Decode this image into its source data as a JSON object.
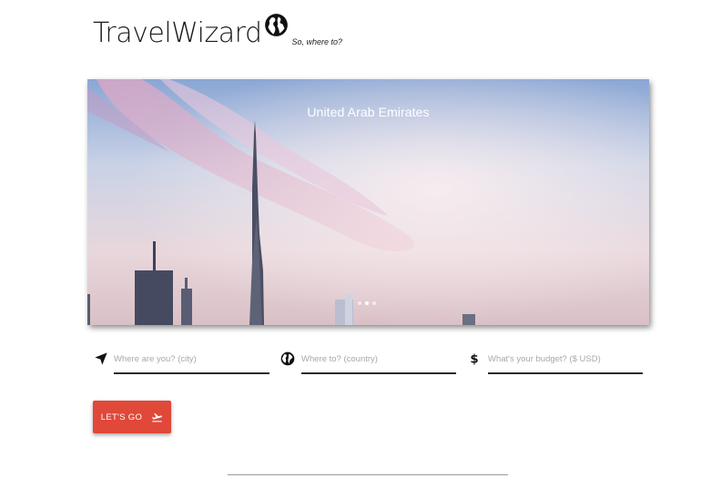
{
  "brand": {
    "title": "TravelWizard",
    "tagline": "So, where to?",
    "logo_icon": "globe-icon"
  },
  "carousel": {
    "caption": "United Arab Emirates",
    "slide_count": 3,
    "active_slide": 2
  },
  "form": {
    "origin": {
      "placeholder": "Where are you? (city)",
      "icon": "location-arrow-icon"
    },
    "destination": {
      "placeholder": "Where to? (country)",
      "icon": "globe-icon"
    },
    "budget": {
      "placeholder": "What's your budget? ($ USD)",
      "icon": "dollar-icon"
    }
  },
  "submit": {
    "label": "LET'S GO",
    "icon": "flight-takeoff-icon",
    "color": "#e0483a"
  }
}
